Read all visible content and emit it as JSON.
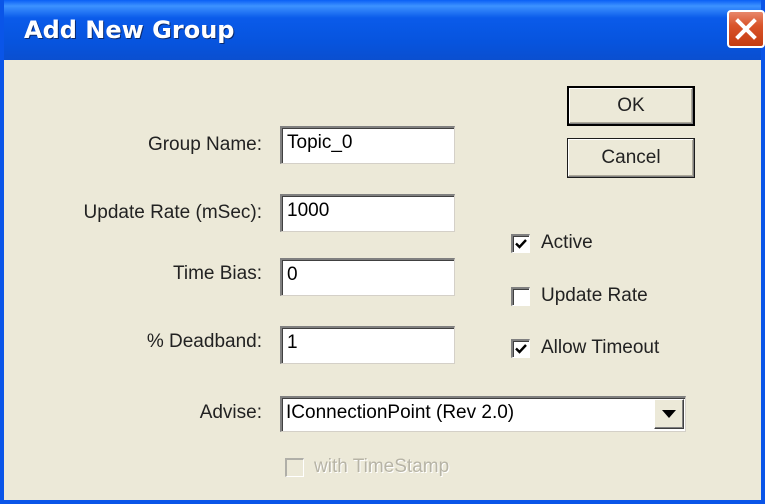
{
  "window": {
    "title": "Add New Group"
  },
  "fields": {
    "group_name": {
      "label": "Group Name:",
      "value": "Topic_0"
    },
    "update_rate": {
      "label": "Update Rate (mSec):",
      "value": "1000"
    },
    "time_bias": {
      "label": "Time Bias:",
      "value": "0"
    },
    "deadband": {
      "label": "% Deadband:",
      "value": "1"
    },
    "advise": {
      "label": "Advise:",
      "value": "IConnectionPoint (Rev 2.0)"
    }
  },
  "buttons": {
    "ok": "OK",
    "cancel": "Cancel"
  },
  "checkboxes": {
    "active": {
      "label": "Active",
      "checked": true
    },
    "update_rate": {
      "label": "Update Rate",
      "checked": false
    },
    "allow_timeout": {
      "label": "Allow Timeout",
      "checked": true
    },
    "with_timestamp": {
      "label": "with TimeStamp",
      "checked": false,
      "disabled": true
    }
  },
  "icons": {
    "close": "close-icon",
    "check": "check-icon",
    "dropdown": "chevron-down-icon"
  },
  "colors": {
    "titlebar": "#0A5BEA",
    "close": "#D9542A",
    "face": "#ECE9D8"
  }
}
